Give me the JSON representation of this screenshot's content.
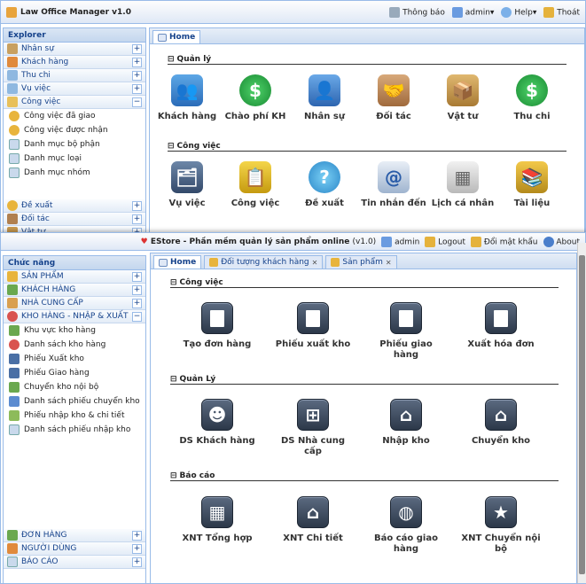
{
  "w1": {
    "title": "Law Office Manager v1.0",
    "topbar": [
      "Thông báo",
      "admin▾",
      "Help▾",
      "Thoát"
    ],
    "sidebar_header": "Explorer",
    "groups": [
      "Nhân sự",
      "Khách hàng",
      "Thu chi",
      "Vụ việc",
      "Công việc"
    ],
    "sub": [
      "Công việc đã giao",
      "Công việc được nhận",
      "Danh mục bộ phận",
      "Danh mục loại",
      "Danh mục nhóm"
    ],
    "groups2": [
      "Đề xuất",
      "Đối tác",
      "Vật tư"
    ],
    "tab": "Home",
    "sec1": "Quản lý",
    "sec2": "Công việc",
    "row1": [
      "Khách hàng",
      "Chào phí KH",
      "Nhân sự",
      "Đối tác",
      "Vật tư",
      "Thu chi"
    ],
    "row2": [
      "Vụ việc",
      "Công việc",
      "Đề xuất",
      "Tin nhắn đến",
      "Lịch cá nhân",
      "Tài liệu"
    ]
  },
  "w2": {
    "title": "EStore - Phần mềm quản lý sản phẩm online",
    "version": "(v1.0)",
    "user": "admin",
    "logout": "Logout",
    "pwd": "Đổi mật khẩu",
    "about": "About",
    "sidebar_header": "Chức năng",
    "groups": [
      "SẢN PHẨM",
      "KHÁCH HÀNG",
      "NHÀ CUNG CẤP",
      "KHO HÀNG - NHẬP & XUẤT"
    ],
    "sub": [
      "Khu vực kho hàng",
      "Danh sách kho hàng",
      "Phiếu Xuất kho",
      "Phiếu Giao hàng",
      "Chuyển kho nội bộ",
      "Danh sách phiếu chuyển kho",
      "Phiếu nhập kho & chi tiết",
      "Danh sách phiếu nhập kho"
    ],
    "groups2": [
      "ĐƠN HÀNG",
      "NGƯỜI DÙNG",
      "BÁO CÁO"
    ],
    "tabs": [
      "Home",
      "Đối tượng khách hàng",
      "Sản phẩm"
    ],
    "sec1": "Công việc",
    "sec2": "Quản Lý",
    "sec3": "Báo cáo",
    "row1": [
      "Tạo đơn hàng",
      "Phiếu xuất kho",
      "Phiếu giao hàng",
      "Xuất hóa đơn"
    ],
    "row2": [
      "DS Khách hàng",
      "DS Nhà cung cấp",
      "Nhập kho",
      "Chuyển kho"
    ],
    "row3": [
      "XNT Tổng hợp",
      "XNT Chi tiết",
      "Báo cáo giao hàng",
      "XNT Chuyển nội bộ"
    ]
  }
}
